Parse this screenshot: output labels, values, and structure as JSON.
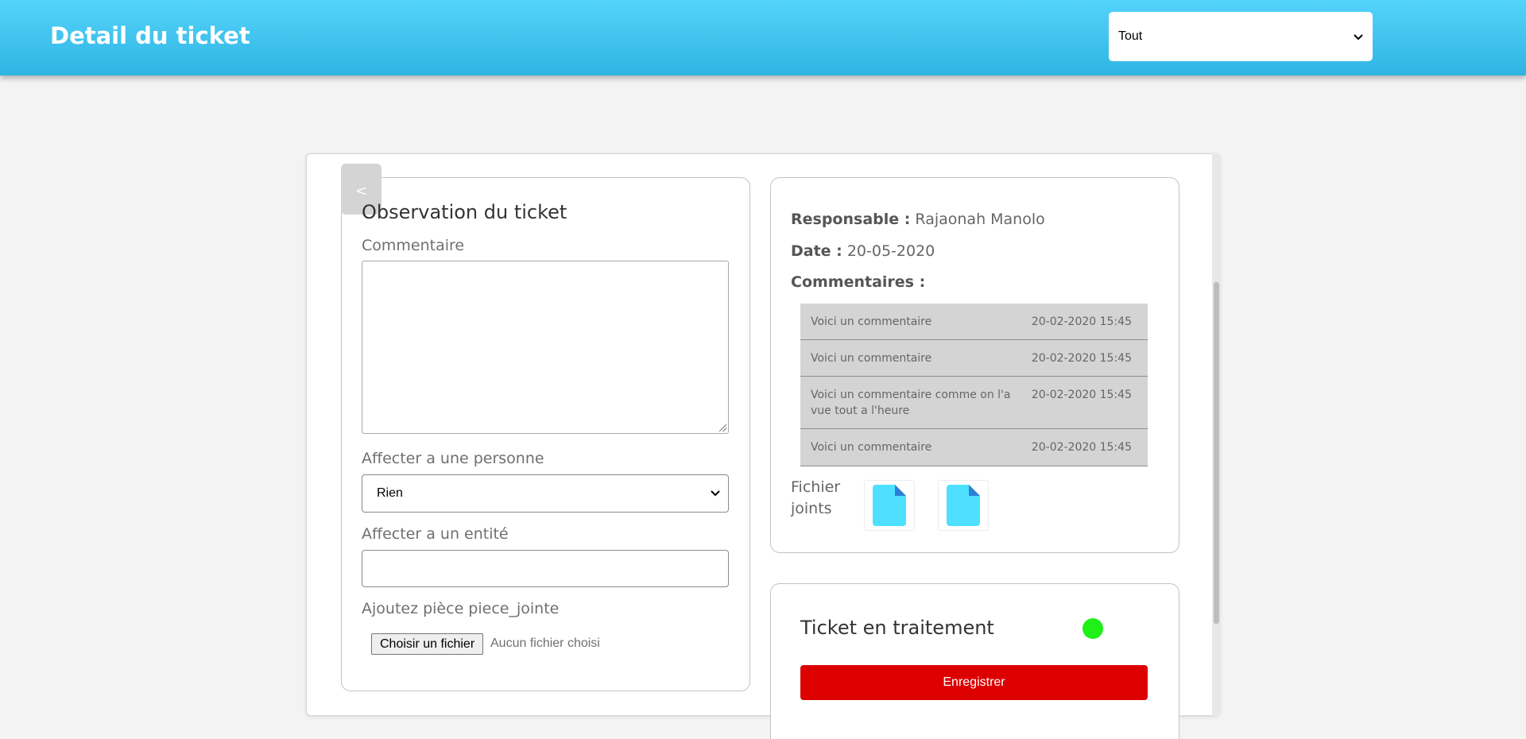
{
  "header": {
    "title": "Detail du ticket",
    "filter_value": "Tout"
  },
  "back_button": {
    "label": "<"
  },
  "observation": {
    "title": "Observation du ticket",
    "comment_label": "Commentaire",
    "comment_value": "",
    "assign_person_label": "Affecter a une personne",
    "assign_person_value": "Rien",
    "assign_entity_label": "Affecter a un entité",
    "assign_entity_value": "",
    "attachment_label": "Ajoutez pièce piece_jointe",
    "file_button": "Choisir un fichier",
    "file_status": "Aucun fichier choisi"
  },
  "info": {
    "responsable_label": "Responsable :",
    "responsable_value": "Rajaonah Manolo",
    "date_label": "Date :",
    "date_value": "20-05-2020",
    "comments_label": "Commentaires :",
    "comments": [
      {
        "text": "Voici un commentaire",
        "datetime": "20-02-2020 15:45"
      },
      {
        "text": "Voici un commentaire",
        "datetime": "20-02-2020 15:45"
      },
      {
        "text": "Voici un commentaire comme on l'a vue tout a l'heure",
        "datetime": "20-02-2020 15:45"
      },
      {
        "text": "Voici un commentaire",
        "datetime": "20-02-2020 15:45"
      }
    ],
    "attachments_label": "Fichier joints",
    "attachments": [
      {
        "icon": "file-icon"
      },
      {
        "icon": "file-icon"
      }
    ]
  },
  "status": {
    "title": "Ticket en traitement",
    "indicator_color": "#1ef018",
    "save_label": "Enregistrer",
    "save_color": "#dd0000"
  },
  "theme": {
    "header_gradient_top": "#54d4fb",
    "header_gradient_bottom": "#2fb4e2",
    "file_icon_color": "#4fe0ff"
  }
}
